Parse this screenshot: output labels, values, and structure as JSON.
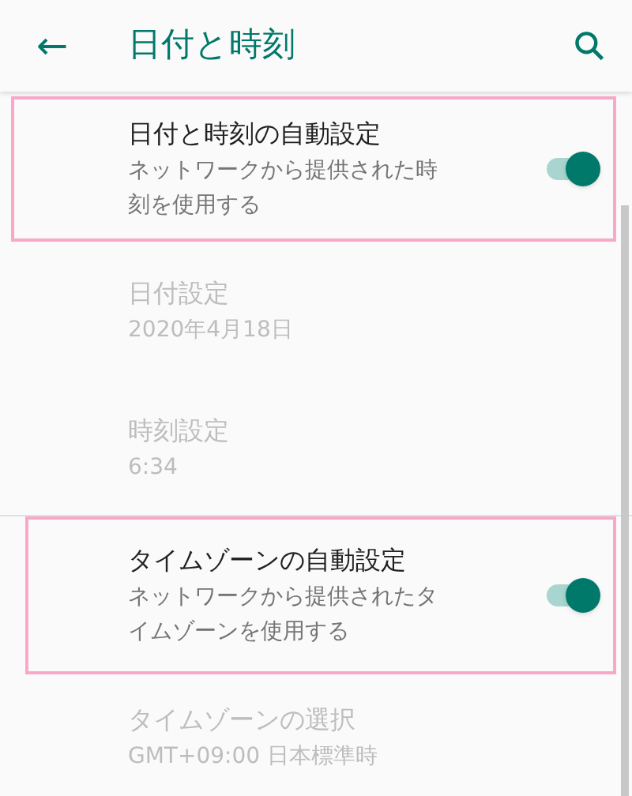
{
  "header": {
    "back": "←",
    "title": "日付と時刻"
  },
  "items": [
    {
      "kind": "switch",
      "title": "日付と時刻の自動設定",
      "summary": "ネットワークから提供された時刻を使用する",
      "on": true,
      "disabled": false,
      "highlighted": true,
      "divider_above": false
    },
    {
      "kind": "plain",
      "title": "日付設定",
      "summary": "2020年4月18日",
      "disabled": true,
      "highlighted": false,
      "divider_above": false
    },
    {
      "kind": "plain",
      "title": "時刻設定",
      "summary": "6:34",
      "disabled": true,
      "highlighted": false,
      "divider_above": false
    },
    {
      "kind": "switch",
      "title": "タイムゾーンの自動設定",
      "summary": "ネットワークから提供されたタイムゾーンを使用する",
      "on": true,
      "disabled": false,
      "highlighted": true,
      "divider_above": true
    },
    {
      "kind": "plain",
      "title": "タイムゾーンの選択",
      "summary": "GMT+09:00 日本標準時",
      "disabled": true,
      "highlighted": false,
      "divider_above": false
    }
  ]
}
